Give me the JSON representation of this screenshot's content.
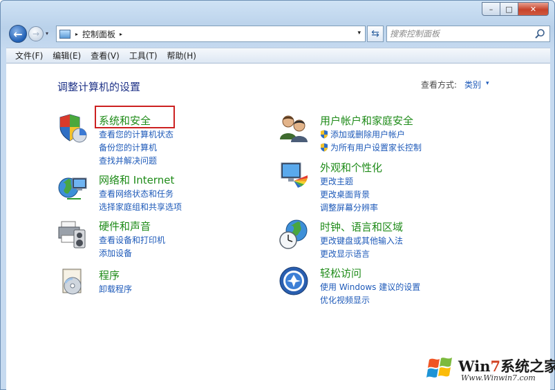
{
  "window": {
    "caption": {
      "minimize_glyph": "–",
      "maximize_glyph": "□",
      "close_glyph": "✕"
    }
  },
  "nav": {
    "back_glyph": "←",
    "forward_glyph": "→",
    "address": {
      "breadcrumb": "控制面板",
      "separator_glyph": "▸"
    },
    "dropdown_glyph": "▾",
    "refresh_glyph": "⇆",
    "search": {
      "placeholder": "搜索控制面板"
    }
  },
  "menu": [
    {
      "label": "文件(F)"
    },
    {
      "label": "编辑(E)"
    },
    {
      "label": "查看(V)"
    },
    {
      "label": "工具(T)"
    },
    {
      "label": "帮助(H)"
    }
  ],
  "main": {
    "title": "调整计算机的设置",
    "view_by_label": "查看方式:",
    "view_by_value": "类别",
    "view_caret": "▾"
  },
  "categories": {
    "system": {
      "title": "系统和安全",
      "icon": "shield-security-icon",
      "links": [
        "查看您的计算机状态",
        "备份您的计算机",
        "查找并解决问题"
      ]
    },
    "network": {
      "title": "网络和 Internet",
      "icon": "network-globe-icon",
      "links": [
        "查看网络状态和任务",
        "选择家庭组和共享选项"
      ]
    },
    "hardware": {
      "title": "硬件和声音",
      "icon": "printer-speaker-icon",
      "links": [
        "查看设备和打印机",
        "添加设备"
      ]
    },
    "programs": {
      "title": "程序",
      "icon": "programs-disc-icon",
      "links": [
        "卸载程序"
      ]
    },
    "users": {
      "title": "用户帐户和家庭安全",
      "icon": "users-icon",
      "links": [
        "添加或删除用户帐户",
        "为所有用户设置家长控制"
      ]
    },
    "appearance": {
      "title": "外观和个性化",
      "icon": "monitor-palette-icon",
      "links": [
        "更改主题",
        "更改桌面背景",
        "调整屏幕分辨率"
      ]
    },
    "clock": {
      "title": "时钟、语言和区域",
      "icon": "clock-globe-icon",
      "links": [
        "更改键盘或其他输入法",
        "更改显示语言"
      ]
    },
    "access": {
      "title": "轻松访问",
      "icon": "ease-of-access-icon",
      "links": [
        "使用 Windows 建议的设置",
        "优化视频显示"
      ]
    }
  },
  "watermark": {
    "brand_prefix": "Win",
    "brand_seven": "7",
    "brand_suffix": "系统之家",
    "url": "Www.Winwin7.com"
  }
}
